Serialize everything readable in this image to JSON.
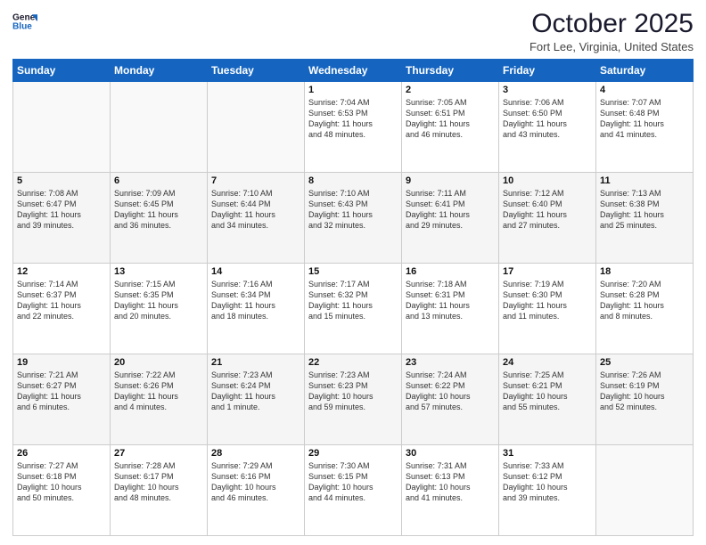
{
  "header": {
    "logo_line1": "General",
    "logo_line2": "Blue",
    "month": "October 2025",
    "location": "Fort Lee, Virginia, United States"
  },
  "days_of_week": [
    "Sunday",
    "Monday",
    "Tuesday",
    "Wednesday",
    "Thursday",
    "Friday",
    "Saturday"
  ],
  "weeks": [
    [
      {
        "day": "",
        "info": ""
      },
      {
        "day": "",
        "info": ""
      },
      {
        "day": "",
        "info": ""
      },
      {
        "day": "1",
        "info": "Sunrise: 7:04 AM\nSunset: 6:53 PM\nDaylight: 11 hours\nand 48 minutes."
      },
      {
        "day": "2",
        "info": "Sunrise: 7:05 AM\nSunset: 6:51 PM\nDaylight: 11 hours\nand 46 minutes."
      },
      {
        "day": "3",
        "info": "Sunrise: 7:06 AM\nSunset: 6:50 PM\nDaylight: 11 hours\nand 43 minutes."
      },
      {
        "day": "4",
        "info": "Sunrise: 7:07 AM\nSunset: 6:48 PM\nDaylight: 11 hours\nand 41 minutes."
      }
    ],
    [
      {
        "day": "5",
        "info": "Sunrise: 7:08 AM\nSunset: 6:47 PM\nDaylight: 11 hours\nand 39 minutes."
      },
      {
        "day": "6",
        "info": "Sunrise: 7:09 AM\nSunset: 6:45 PM\nDaylight: 11 hours\nand 36 minutes."
      },
      {
        "day": "7",
        "info": "Sunrise: 7:10 AM\nSunset: 6:44 PM\nDaylight: 11 hours\nand 34 minutes."
      },
      {
        "day": "8",
        "info": "Sunrise: 7:10 AM\nSunset: 6:43 PM\nDaylight: 11 hours\nand 32 minutes."
      },
      {
        "day": "9",
        "info": "Sunrise: 7:11 AM\nSunset: 6:41 PM\nDaylight: 11 hours\nand 29 minutes."
      },
      {
        "day": "10",
        "info": "Sunrise: 7:12 AM\nSunset: 6:40 PM\nDaylight: 11 hours\nand 27 minutes."
      },
      {
        "day": "11",
        "info": "Sunrise: 7:13 AM\nSunset: 6:38 PM\nDaylight: 11 hours\nand 25 minutes."
      }
    ],
    [
      {
        "day": "12",
        "info": "Sunrise: 7:14 AM\nSunset: 6:37 PM\nDaylight: 11 hours\nand 22 minutes."
      },
      {
        "day": "13",
        "info": "Sunrise: 7:15 AM\nSunset: 6:35 PM\nDaylight: 11 hours\nand 20 minutes."
      },
      {
        "day": "14",
        "info": "Sunrise: 7:16 AM\nSunset: 6:34 PM\nDaylight: 11 hours\nand 18 minutes."
      },
      {
        "day": "15",
        "info": "Sunrise: 7:17 AM\nSunset: 6:32 PM\nDaylight: 11 hours\nand 15 minutes."
      },
      {
        "day": "16",
        "info": "Sunrise: 7:18 AM\nSunset: 6:31 PM\nDaylight: 11 hours\nand 13 minutes."
      },
      {
        "day": "17",
        "info": "Sunrise: 7:19 AM\nSunset: 6:30 PM\nDaylight: 11 hours\nand 11 minutes."
      },
      {
        "day": "18",
        "info": "Sunrise: 7:20 AM\nSunset: 6:28 PM\nDaylight: 11 hours\nand 8 minutes."
      }
    ],
    [
      {
        "day": "19",
        "info": "Sunrise: 7:21 AM\nSunset: 6:27 PM\nDaylight: 11 hours\nand 6 minutes."
      },
      {
        "day": "20",
        "info": "Sunrise: 7:22 AM\nSunset: 6:26 PM\nDaylight: 11 hours\nand 4 minutes."
      },
      {
        "day": "21",
        "info": "Sunrise: 7:23 AM\nSunset: 6:24 PM\nDaylight: 11 hours\nand 1 minute."
      },
      {
        "day": "22",
        "info": "Sunrise: 7:23 AM\nSunset: 6:23 PM\nDaylight: 10 hours\nand 59 minutes."
      },
      {
        "day": "23",
        "info": "Sunrise: 7:24 AM\nSunset: 6:22 PM\nDaylight: 10 hours\nand 57 minutes."
      },
      {
        "day": "24",
        "info": "Sunrise: 7:25 AM\nSunset: 6:21 PM\nDaylight: 10 hours\nand 55 minutes."
      },
      {
        "day": "25",
        "info": "Sunrise: 7:26 AM\nSunset: 6:19 PM\nDaylight: 10 hours\nand 52 minutes."
      }
    ],
    [
      {
        "day": "26",
        "info": "Sunrise: 7:27 AM\nSunset: 6:18 PM\nDaylight: 10 hours\nand 50 minutes."
      },
      {
        "day": "27",
        "info": "Sunrise: 7:28 AM\nSunset: 6:17 PM\nDaylight: 10 hours\nand 48 minutes."
      },
      {
        "day": "28",
        "info": "Sunrise: 7:29 AM\nSunset: 6:16 PM\nDaylight: 10 hours\nand 46 minutes."
      },
      {
        "day": "29",
        "info": "Sunrise: 7:30 AM\nSunset: 6:15 PM\nDaylight: 10 hours\nand 44 minutes."
      },
      {
        "day": "30",
        "info": "Sunrise: 7:31 AM\nSunset: 6:13 PM\nDaylight: 10 hours\nand 41 minutes."
      },
      {
        "day": "31",
        "info": "Sunrise: 7:33 AM\nSunset: 6:12 PM\nDaylight: 10 hours\nand 39 minutes."
      },
      {
        "day": "",
        "info": ""
      }
    ]
  ]
}
